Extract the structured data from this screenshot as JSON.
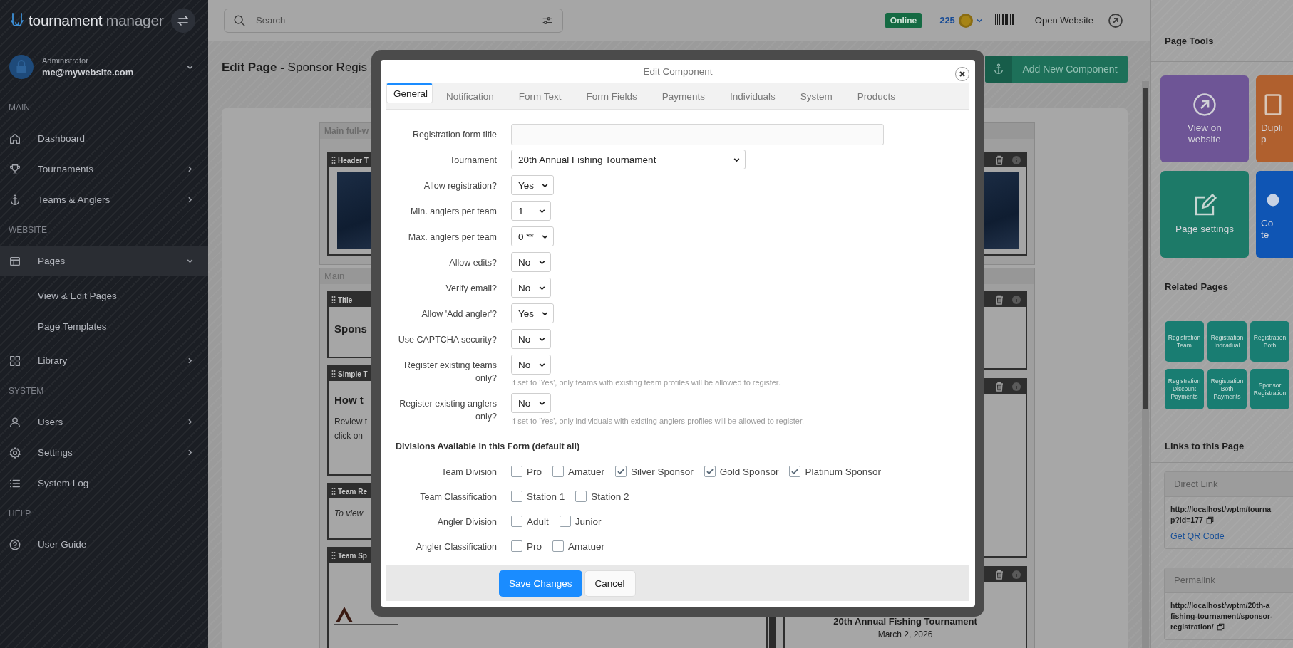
{
  "sidebar": {
    "brand": {
      "first": "tournament",
      "second": "manager"
    },
    "user": {
      "role": "Administrator",
      "email": "me@mywebsite.com"
    },
    "sections": [
      {
        "heading": "MAIN",
        "items": [
          {
            "label": "Dashboard",
            "selected": false
          },
          {
            "label": "Tournaments",
            "selected": false,
            "expanded": false
          },
          {
            "label": "Teams & Anglers",
            "selected": false,
            "expanded": false
          }
        ]
      },
      {
        "heading": "WEBSITE",
        "items": [
          {
            "label": "Pages",
            "selected": true,
            "expanded": true,
            "children": [
              {
                "label": "View & Edit Pages",
                "selected": false
              },
              {
                "label": "Page Templates",
                "selected": false
              }
            ]
          },
          {
            "label": "Library",
            "selected": false,
            "expanded": false
          }
        ]
      },
      {
        "heading": "SYSTEM",
        "items": [
          {
            "label": "Users",
            "selected": false,
            "expanded": false
          },
          {
            "label": "Settings",
            "selected": false,
            "expanded": false
          },
          {
            "label": "System Log",
            "selected": false
          }
        ]
      },
      {
        "heading": "HELP",
        "items": [
          {
            "label": "User Guide",
            "selected": false
          }
        ]
      }
    ]
  },
  "topbar": {
    "search": {
      "placeholder": "Search"
    },
    "status": "Online",
    "points": "225",
    "link": "Open Website"
  },
  "page": {
    "title": "**Edit Page -** Sponsor Regis",
    "add_button": "Add New Component"
  },
  "editor": {
    "full_width_label": "Main full-w",
    "header_block": {
      "title": "Header T"
    },
    "main_label": "Main",
    "left_blocks": [
      {
        "kind": "heading",
        "title": "Title",
        "text": "Spons"
      },
      {
        "kind": "richtext",
        "title": "Simple T",
        "text": "How t",
        "lines": [
          "Review t",
          "click on"
        ]
      },
      {
        "kind": "note",
        "title": "Team Re",
        "text": "To view"
      },
      {
        "kind": "logo",
        "title": "Team Sp"
      }
    ],
    "right_blocks": [
      {
        "kind": "blank"
      },
      {
        "kind": "blank"
      },
      {
        "kind": "event",
        "text": "20th Annual Fishing Tournament",
        "date": "March 2, 2026"
      }
    ]
  },
  "modal": {
    "title": "Edit Component",
    "tabs": [
      {
        "label": "General",
        "selected": true
      },
      {
        "label": "Notification",
        "selected": false
      },
      {
        "label": "Form Text",
        "selected": false
      },
      {
        "label": "Form Fields",
        "selected": false
      },
      {
        "label": "Payments",
        "selected": false
      },
      {
        "label": "Individuals",
        "selected": false
      },
      {
        "label": "System",
        "selected": false
      },
      {
        "label": "Products",
        "selected": false
      }
    ],
    "fields": [
      {
        "kind": "text",
        "label": "Registration form title"
      },
      {
        "kind": "combo",
        "label": "Tournament",
        "value": "20th Annual Fishing Tournament"
      },
      {
        "kind": "select",
        "label": "Allow registration?",
        "value": "Yes"
      },
      {
        "kind": "select",
        "label": "Min. anglers per team",
        "value": "1"
      },
      {
        "kind": "select",
        "label": "Max. anglers per team",
        "value": "0 **"
      },
      {
        "kind": "select",
        "label": "Allow edits?",
        "value": "No"
      },
      {
        "kind": "select",
        "label": "Verify email?",
        "value": "No"
      },
      {
        "kind": "select",
        "label": "Allow 'Add angler'?",
        "value": "Yes"
      },
      {
        "kind": "select",
        "label": "Use CAPTCHA security?",
        "value": "No"
      },
      {
        "kind": "select",
        "label": "Register existing teams only?",
        "value": "No",
        "hint": "If set to 'Yes', only teams with existing team profiles will be allowed to register."
      },
      {
        "kind": "select",
        "label": "Register existing anglers only?",
        "value": "No",
        "hint": "If set to 'Yes', only individuals with existing anglers profiles will be allowed to register."
      }
    ],
    "divisions_heading": "Divisions Available in this Form (default all)",
    "division_groups": [
      {
        "label": "Team Division",
        "options": [
          {
            "label": "Pro",
            "checked": false
          },
          {
            "label": "Amatuer",
            "checked": false
          },
          {
            "label": "Silver Sponsor",
            "checked": true
          },
          {
            "label": "Gold Sponsor",
            "checked": true
          },
          {
            "label": "Platinum Sponsor",
            "checked": true
          }
        ]
      },
      {
        "label": "Team Classification",
        "options": [
          {
            "label": "Station 1",
            "checked": false
          },
          {
            "label": "Station 2",
            "checked": false
          }
        ]
      },
      {
        "label": "Angler Division",
        "options": [
          {
            "label": "Adult",
            "checked": false
          },
          {
            "label": "Junior",
            "checked": false
          }
        ]
      },
      {
        "label": "Angler Classification",
        "options": [
          {
            "label": "Pro",
            "checked": false
          },
          {
            "label": "Amatuer",
            "checked": false
          }
        ]
      }
    ],
    "buttons": [
      {
        "label": "Save Changes",
        "kind": "primary"
      },
      {
        "label": "Cancel",
        "kind": "secondary"
      }
    ]
  },
  "right_panel": {
    "tools_heading": "Page Tools",
    "tools": [
      {
        "lines": [
          "View on",
          "website"
        ],
        "color": "#6e5596"
      },
      {
        "lines": [
          "Dupli",
          "p"
        ],
        "color": "#b0602e"
      },
      {
        "lines": [
          "Page settings"
        ],
        "color": "#1d7a68"
      },
      {
        "lines": [
          "Co",
          "te"
        ],
        "color": "#0f55b4"
      }
    ],
    "related_heading": "Related Pages",
    "related": [
      {
        "lines": [
          "Registration",
          "Team"
        ]
      },
      {
        "lines": [
          "Registration",
          "Individual"
        ]
      },
      {
        "lines": [
          "Registration",
          "Both"
        ]
      },
      {
        "lines": [
          "Registration",
          "Discount",
          "Payments"
        ]
      },
      {
        "lines": [
          "Registration",
          "Both",
          "Payments"
        ]
      },
      {
        "lines": [
          "Sponsor",
          "Registration"
        ]
      }
    ],
    "links_heading": "Links to this Page",
    "links": [
      {
        "heading": "Direct Link",
        "lines": [
          "http://localhost/wptm/tourna",
          "p?id=177"
        ],
        "action": "Get QR Code"
      },
      {
        "heading": "Permalink",
        "lines": [
          "http://localhost/wptm/20th-a",
          "fishing-tournament/sponsor-",
          "registration/"
        ]
      }
    ]
  }
}
